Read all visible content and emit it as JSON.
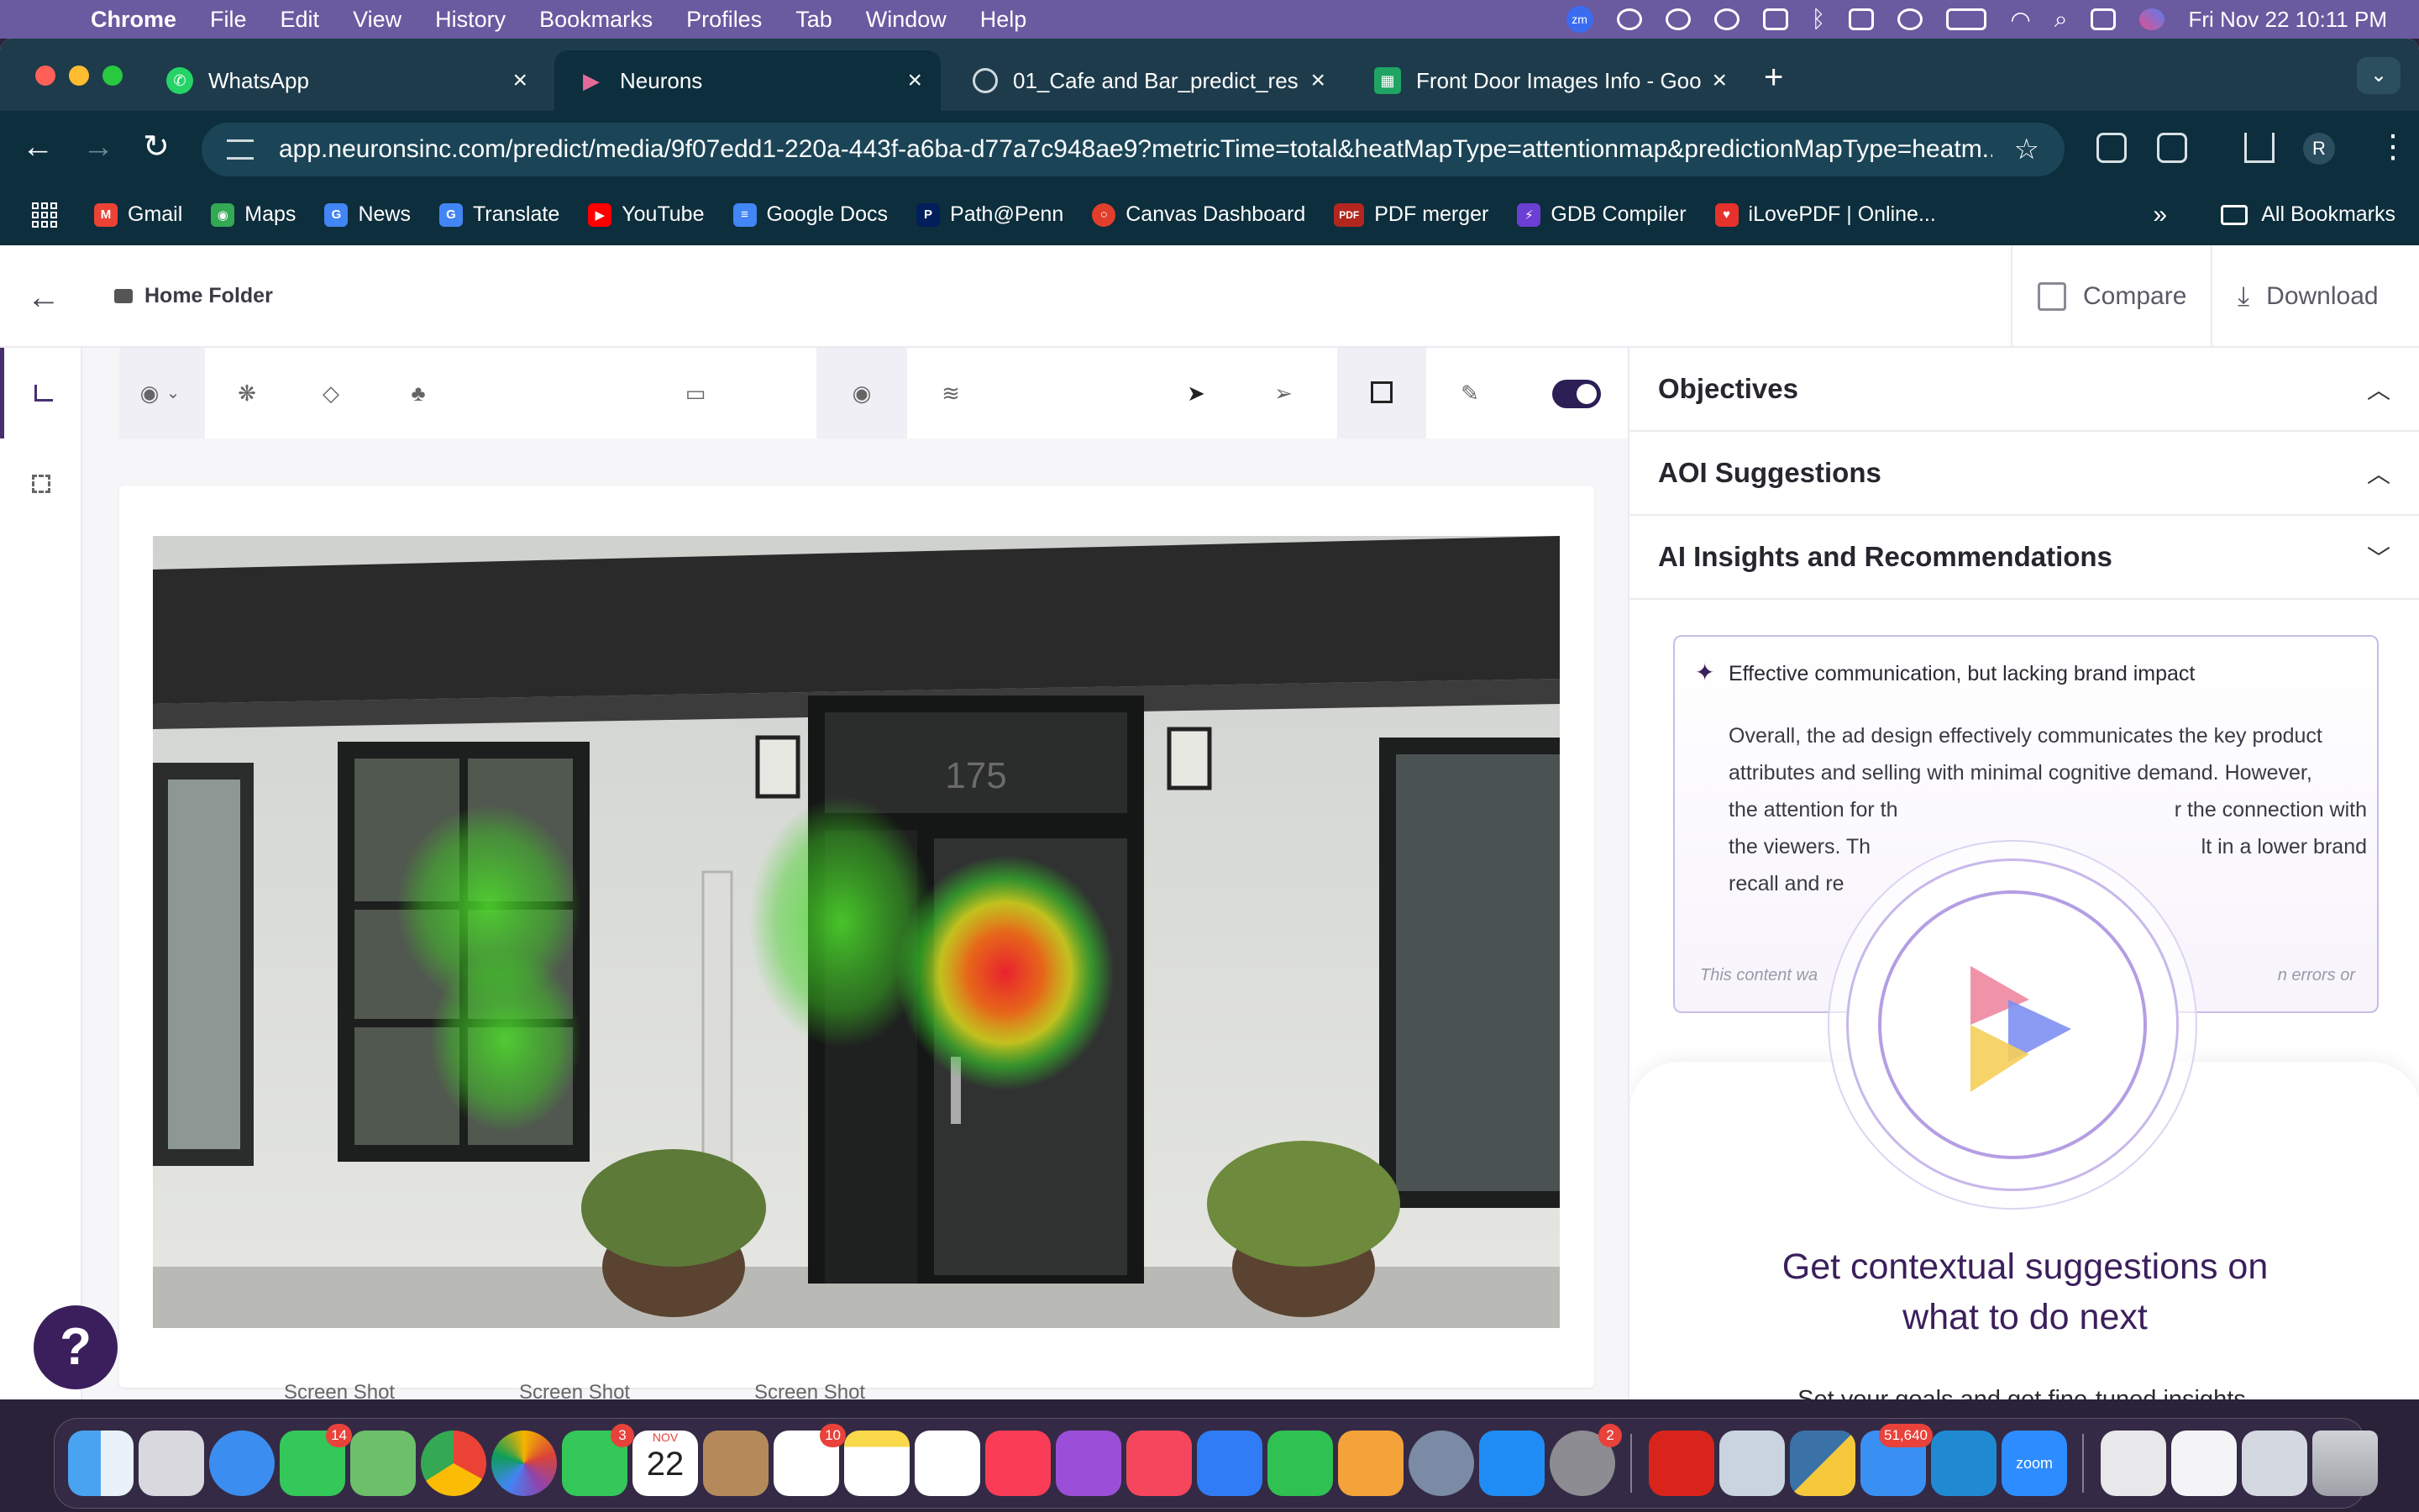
{
  "menubar": {
    "app": "Chrome",
    "items": [
      "File",
      "Edit",
      "View",
      "History",
      "Bookmarks",
      "Profiles",
      "Tab",
      "Window",
      "Help"
    ],
    "clock": "Fri Nov 22  10:11 PM",
    "zm_label": "zm"
  },
  "tabs": [
    {
      "title": "WhatsApp",
      "icon": "whatsapp-icon",
      "color": "#25d366"
    },
    {
      "title": "Neurons",
      "icon": "neurons-icon",
      "color": "#e56a9a"
    },
    {
      "title": "01_Cafe and Bar_predict_res",
      "icon": "globe-icon",
      "color": "#9aa8b0"
    },
    {
      "title": "Front Door Images Info - Goo",
      "icon": "sheets-icon",
      "color": "#1fa463"
    }
  ],
  "toolbar": {
    "url": "app.neuronsinc.com/predict/media/9f07edd1-220a-443f-a6ba-d77a7c948ae9?metricTime=total&heatMapType=attentionmap&predictionMapType=heatm...",
    "profile_initial": "R"
  },
  "bookmarks": {
    "items": [
      {
        "label": "Gmail",
        "color": "#ea4335",
        "glyph": "M"
      },
      {
        "label": "Maps",
        "color": "#34a853",
        "glyph": "◉"
      },
      {
        "label": "News",
        "color": "#4285f4",
        "glyph": "G"
      },
      {
        "label": "Translate",
        "color": "#4285f4",
        "glyph": "G"
      },
      {
        "label": "YouTube",
        "color": "#ff0000",
        "glyph": "▶"
      },
      {
        "label": "Google Docs",
        "color": "#4285f4",
        "glyph": "≡"
      },
      {
        "label": "Path@Penn",
        "color": "#011f5b",
        "glyph": "P"
      },
      {
        "label": "Canvas Dashboard",
        "color": "#e13f2b",
        "glyph": "○"
      },
      {
        "label": "PDF merger",
        "color": "#b3261e",
        "glyph": "PDF"
      },
      {
        "label": "GDB Compiler",
        "color": "#6b3fd4",
        "glyph": "⚡"
      },
      {
        "label": "iLovePDF | Online...",
        "color": "#e5322d",
        "glyph": "♥"
      }
    ],
    "more": "»",
    "all_label": "All Bookmarks"
  },
  "app": {
    "breadcrumb": "Home Folder",
    "compare_label": "Compare",
    "download_label": "Download"
  },
  "panel": {
    "sections": [
      {
        "title": "Objectives",
        "chevron": "up"
      },
      {
        "title": "AOI Suggestions",
        "chevron": "up"
      },
      {
        "title": "AI Insights and Recommendations",
        "chevron": "down"
      }
    ],
    "insight_title": "Effective communication, but lacking brand impact",
    "insight_lines": [
      "Overall, the ad design effectively communicates the key product",
      "attributes and selling with minimal cognitive demand. However,",
      "the attention for th",
      "the viewers. Th",
      "recall and re"
    ],
    "insight_lines_right": [
      "",
      "",
      "r the connection with",
      "lt in a lower brand",
      ""
    ],
    "disclaimer_left": "This content wa",
    "disclaimer_right": "n errors or",
    "overlay_title_1": "Get contextual suggestions on",
    "overlay_title_2": "what to do next",
    "overlay_sub": "Set your goals and get fine-tuned insights,"
  },
  "canvas": {
    "door_number": "175",
    "thumb_labels": [
      "Screen Shot",
      "Screen Shot",
      "Screen Shot"
    ]
  },
  "help_label": "?",
  "dock": {
    "calendar_month": "NOV",
    "calendar_day": "22",
    "badges": {
      "messages": "14",
      "facetime": "3",
      "reminders": "10",
      "settings": "2",
      "mail": "51,640"
    },
    "zoom_label": "zoom"
  }
}
